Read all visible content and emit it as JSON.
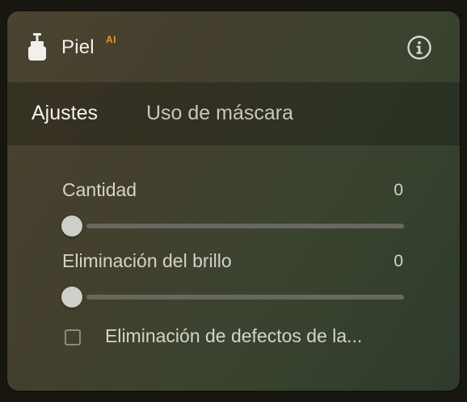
{
  "panel": {
    "title": "Piel",
    "badge": "AI",
    "icon": "skin-tool-icon",
    "info_icon": "info-icon"
  },
  "tabs": [
    {
      "label": "Ajustes",
      "active": true
    },
    {
      "label": "Uso de máscara",
      "active": false
    }
  ],
  "sliders": [
    {
      "label": "Cantidad",
      "value": "0",
      "fraction": 0
    },
    {
      "label": "Eliminación del brillo",
      "value": "0",
      "fraction": 0
    }
  ],
  "checkbox": {
    "label": "Eliminación de defectos de la...",
    "checked": false
  },
  "colors": {
    "accent": "#e79a36",
    "text": "#f2f0ea",
    "track": "#68685f",
    "thumb": "#cfcfca"
  }
}
